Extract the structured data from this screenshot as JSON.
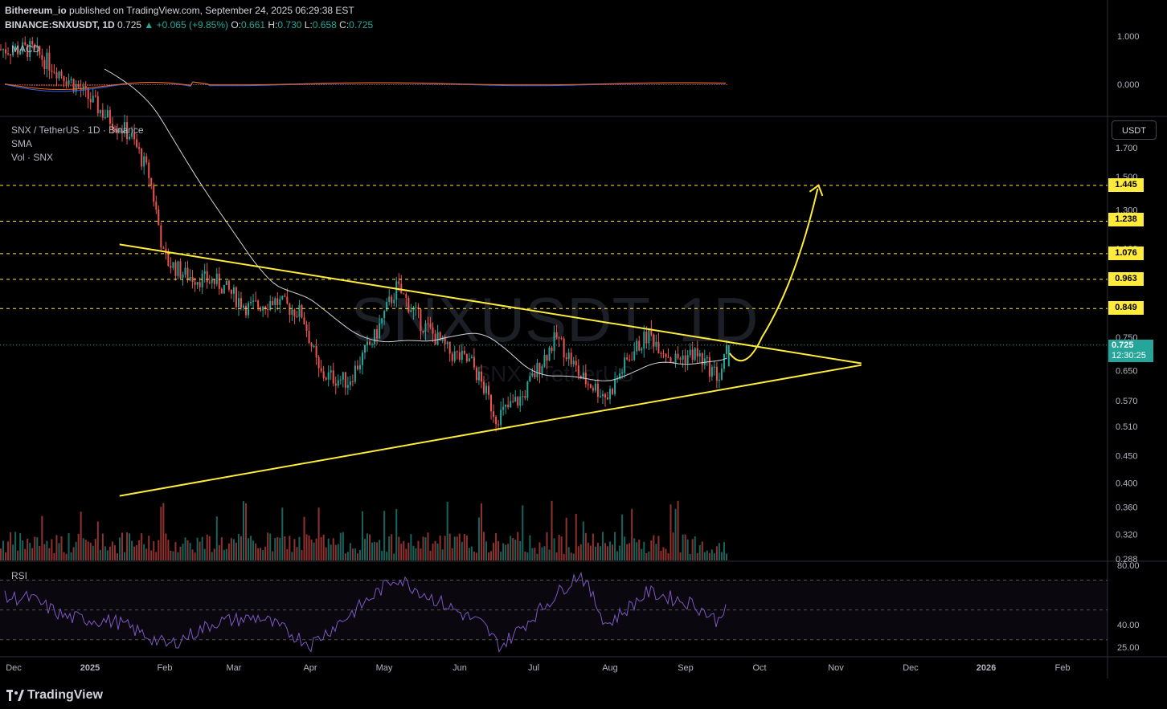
{
  "header": {
    "author": "Bithereum_io",
    "published": "published on TradingView.com, September 24, 2025 06:29:38 EST",
    "symbol": "BINANCE:SNXUSDT, 1D",
    "last": "0.725",
    "change": "▲ +0.065 (+9.85%)",
    "o_label": "O:",
    "o": "0.661",
    "h_label": "H:",
    "h": "0.730",
    "l_label": "L:",
    "l": "0.658",
    "c_label": "C:",
    "c": "0.725"
  },
  "labels": {
    "macd": "MACD",
    "pair": "SNX / TetherUS · 1D · Binance",
    "sma": "SMA",
    "vol": "Vol · SNX",
    "rsi": "RSI",
    "watermark": "SNXUSDT, 1D",
    "watermark_sub": "SNX / TetherUS",
    "unit": "USDT",
    "footer": "TradingView"
  },
  "current_price": {
    "value": "0.725",
    "countdown": "12:30:25"
  },
  "colors": {
    "up": "#26a69a",
    "down": "#ef5350",
    "accent": "#ffeb3b",
    "sma": "#d1d4dc",
    "rsi": "#7e57c2",
    "macd": "#2962ff",
    "signal": "#ff6d00"
  },
  "chart_data": {
    "type": "candlestick",
    "title": "SNX / TetherUS · 1D · Binance",
    "price_scale": [
      "1.700",
      "1.500",
      "1.300",
      "1.100",
      "0.750",
      "0.650",
      "0.570",
      "0.510",
      "0.450",
      "0.400",
      "0.360",
      "0.320",
      "0.288"
    ],
    "rsi_scale": [
      "80.00",
      "40.00",
      "25.00"
    ],
    "macd_scale": [
      "1.000",
      "0.000"
    ],
    "x_ticks": [
      "Dec",
      "2025",
      "Feb",
      "Mar",
      "Apr",
      "May",
      "Jun",
      "Jul",
      "Aug",
      "Sep",
      "Oct",
      "Nov",
      "Dec",
      "2026",
      "Feb"
    ],
    "levels": [
      "1.445",
      "1.238",
      "1.076",
      "0.963",
      "0.849"
    ],
    "triangle": {
      "upper": [
        [
          "2025-01-16",
          1.12
        ],
        [
          "2025-11-18",
          0.67
        ]
      ],
      "lower": [
        [
          "2025-01-16",
          0.378
        ],
        [
          "2025-11-18",
          0.665
        ]
      ]
    },
    "projection": "breakout arrow to 1.445",
    "price_path": [
      [
        "2024-12-10",
        2.6
      ],
      [
        "2024-12-25",
        2.3
      ],
      [
        "2025-01-10",
        1.95
      ],
      [
        "2025-01-20",
        1.8
      ],
      [
        "2025-01-28",
        1.5
      ],
      [
        "2025-02-03",
        1.05
      ],
      [
        "2025-02-12",
        0.98
      ],
      [
        "2025-02-25",
        0.95
      ],
      [
        "2025-03-10",
        0.85
      ],
      [
        "2025-03-20",
        0.88
      ],
      [
        "2025-04-01",
        0.83
      ],
      [
        "2025-04-08",
        0.64
      ],
      [
        "2025-04-20",
        0.62
      ],
      [
        "2025-05-01",
        0.75
      ],
      [
        "2025-05-10",
        0.93
      ],
      [
        "2025-05-20",
        0.8
      ],
      [
        "2025-06-01",
        0.7
      ],
      [
        "2025-06-10",
        0.67
      ],
      [
        "2025-06-20",
        0.53
      ],
      [
        "2025-07-01",
        0.58
      ],
      [
        "2025-07-15",
        0.75
      ],
      [
        "2025-07-25",
        0.63
      ],
      [
        "2025-08-05",
        0.58
      ],
      [
        "2025-08-15",
        0.7
      ],
      [
        "2025-08-22",
        0.76
      ],
      [
        "2025-09-01",
        0.68
      ],
      [
        "2025-09-10",
        0.7
      ],
      [
        "2025-09-20",
        0.63
      ],
      [
        "2025-09-24",
        0.725
      ]
    ],
    "rsi_path": [
      [
        "2024-12-10",
        58
      ],
      [
        "2024-12-25",
        45
      ],
      [
        "2025-01-15",
        42
      ],
      [
        "2025-02-05",
        26
      ],
      [
        "2025-02-25",
        42
      ],
      [
        "2025-03-15",
        45
      ],
      [
        "2025-04-05",
        27
      ],
      [
        "2025-04-25",
        52
      ],
      [
        "2025-05-10",
        72
      ],
      [
        "2025-05-25",
        58
      ],
      [
        "2025-06-15",
        40
      ],
      [
        "2025-06-22",
        25
      ],
      [
        "2025-07-15",
        60
      ],
      [
        "2025-07-25",
        75
      ],
      [
        "2025-08-05",
        40
      ],
      [
        "2025-08-22",
        62
      ],
      [
        "2025-09-10",
        54
      ],
      [
        "2025-09-20",
        42
      ],
      [
        "2025-09-24",
        60
      ]
    ]
  }
}
